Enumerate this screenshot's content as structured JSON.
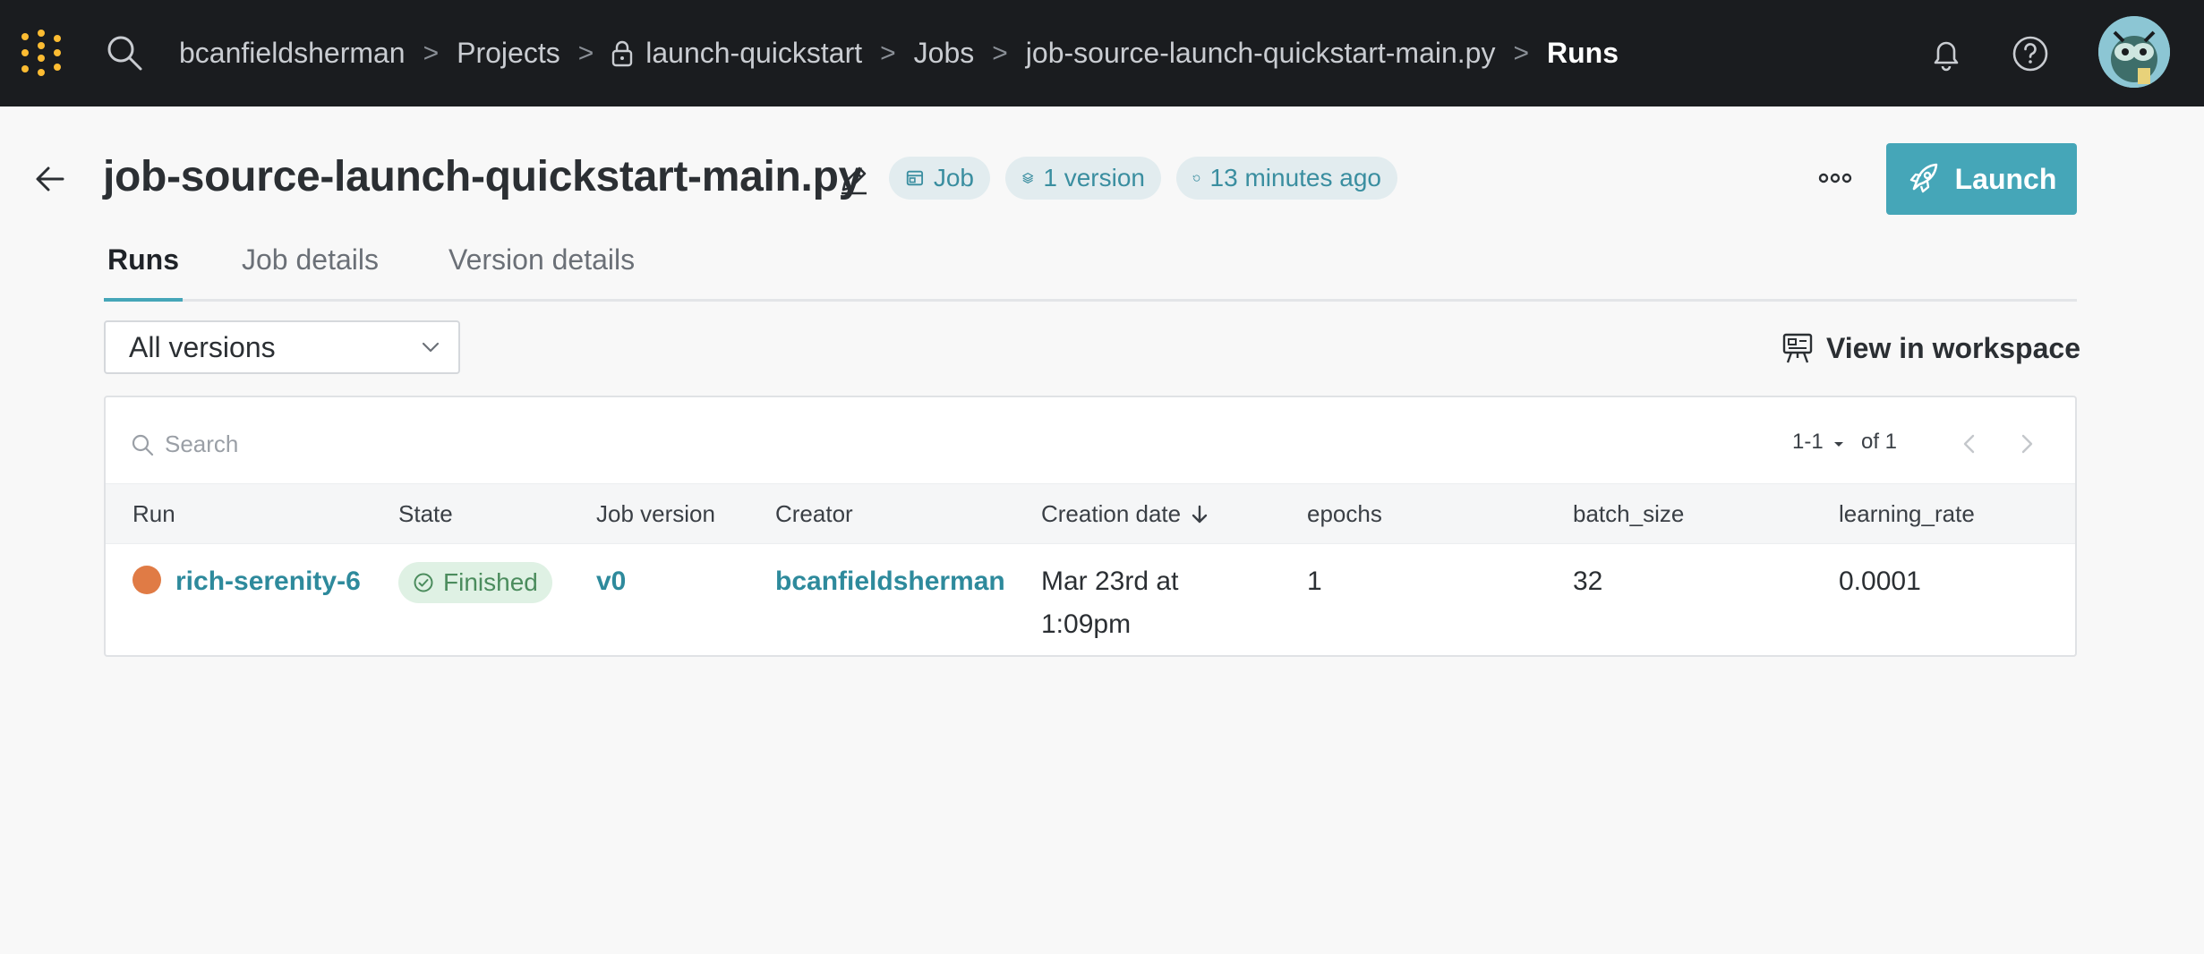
{
  "topbar": {
    "breadcrumb": {
      "entity": "bcanfieldsherman",
      "projects": "Projects",
      "project": "launch-quickstart",
      "jobs": "Jobs",
      "job": "job-source-launch-quickstart-main.py",
      "current": "Runs"
    },
    "separator": ">"
  },
  "header": {
    "title": "job-source-launch-quickstart-main.py",
    "pills": {
      "type": "Job",
      "versions": "1 version",
      "updated": "13 minutes ago"
    },
    "launch_label": "Launch",
    "accent_color": "#45a6b8"
  },
  "tabs": [
    "Runs",
    "Job details",
    "Version details"
  ],
  "filters": {
    "version_select": "All versions",
    "workspace_label": "View in workspace"
  },
  "table": {
    "search_placeholder": "Search",
    "pagination": {
      "range": "1-1",
      "total": "of 1"
    },
    "columns": [
      "Run",
      "State",
      "Job version",
      "Creator",
      "Creation date",
      "epochs",
      "batch_size",
      "learning_rate"
    ],
    "rows": [
      {
        "run": "rich-serenity-6",
        "run_color": "#e07b45",
        "state": "Finished",
        "job_version": "v0",
        "creator": "bcanfieldsherman",
        "creation_date_line1": "Mar 23rd at",
        "creation_date_line2": "1:09pm",
        "epochs": "1",
        "batch_size": "32",
        "learning_rate": "0.0001"
      }
    ]
  }
}
